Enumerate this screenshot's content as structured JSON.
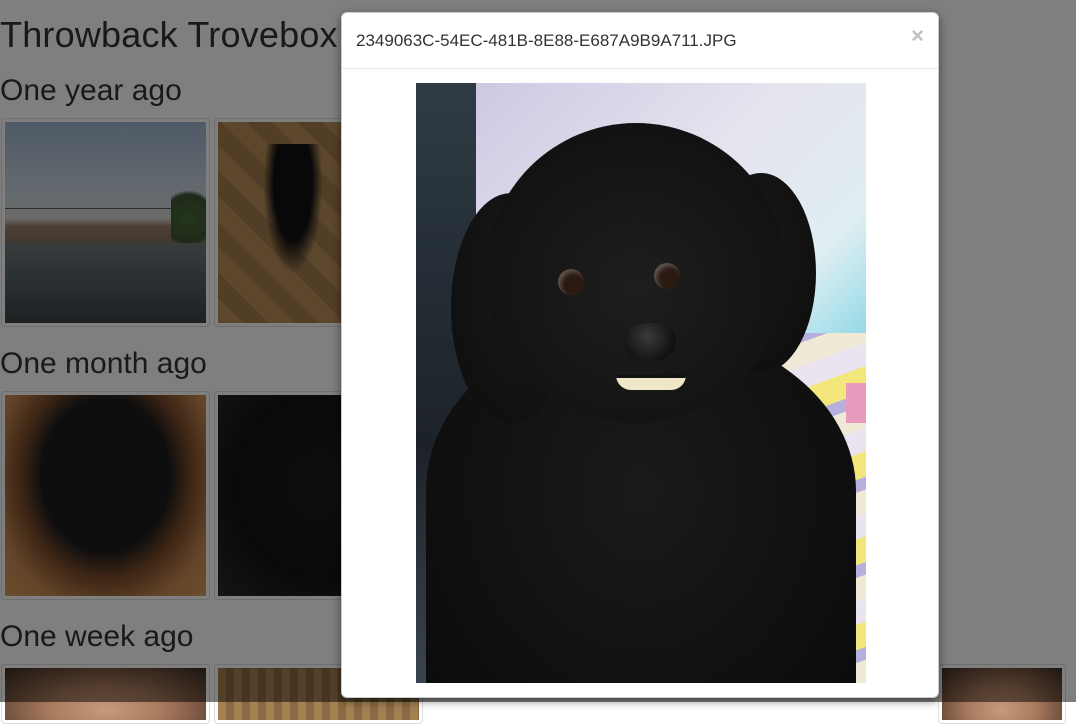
{
  "page": {
    "title": "Throwback Trovebox",
    "sections": [
      {
        "heading": "One year ago"
      },
      {
        "heading": "One month ago"
      },
      {
        "heading": "One week ago"
      }
    ]
  },
  "modal": {
    "title": "2349063C-54EC-481B-8E88-E687A9B9A711.JPG",
    "close_label": "×"
  }
}
